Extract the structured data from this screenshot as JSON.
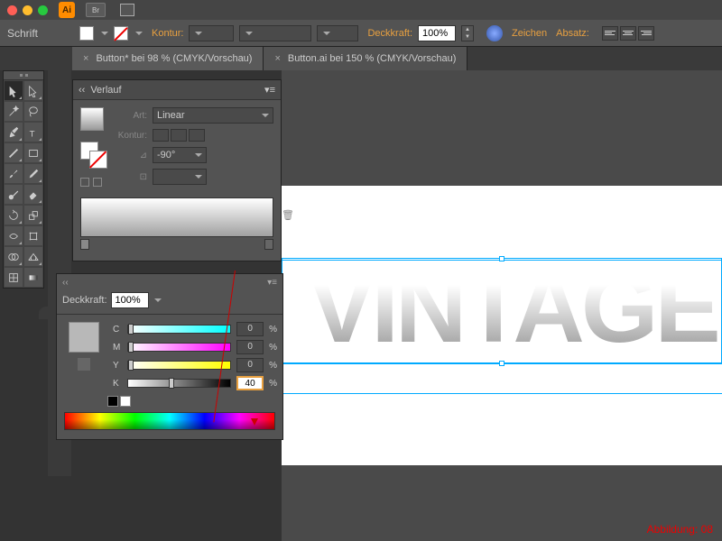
{
  "app": {
    "icon_label": "Ai",
    "bridge_label": "Br"
  },
  "control": {
    "schrift": "Schrift",
    "kontur": "Kontur:",
    "deckkraft": "Deckkraft:",
    "opacity": "100%",
    "zeichen": "Zeichen",
    "absatz": "Absatz:"
  },
  "tabs": [
    {
      "label": "Button* bei 98 % (CMYK/Vorschau)"
    },
    {
      "label": "Button.ai bei 150 % (CMYK/Vorschau)"
    }
  ],
  "gradient": {
    "title": "Verlauf",
    "art_label": "Art:",
    "art_value": "Linear",
    "kontur_label": "Kontur:",
    "angle": "-90°"
  },
  "color": {
    "deckkraft_label": "Deckkraft:",
    "deckkraft_value": "100%",
    "channels": {
      "C": {
        "label": "C",
        "value": "0"
      },
      "M": {
        "label": "M",
        "value": "0"
      },
      "Y": {
        "label": "Y",
        "value": "0"
      },
      "K": {
        "label": "K",
        "value": "40"
      }
    },
    "pct": "%"
  },
  "canvas": {
    "text": "VINTAGE"
  },
  "caption": "Abbildung: 08"
}
